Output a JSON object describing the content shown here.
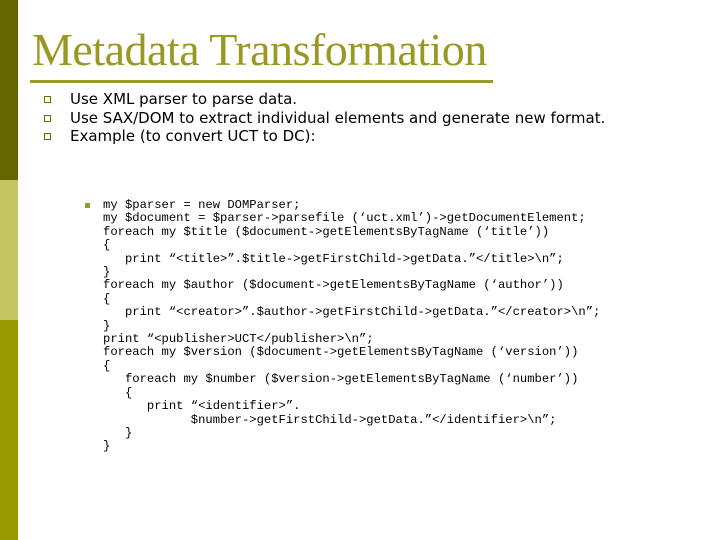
{
  "slide": {
    "title": "Metadata Transformation",
    "colors": {
      "sidebar_dark": "#666600",
      "sidebar_light": "#c3c662",
      "sidebar_mid": "#999900",
      "title": "#999922",
      "rule": "#999933",
      "bullet": "#6b6b00"
    },
    "bullets": [
      {
        "text": "Use XML parser to parse data."
      },
      {
        "text": "Use SAX/DOM to extract individual elements and generate new format."
      },
      {
        "text": "Example (to convert UCT to DC):"
      }
    ],
    "code": {
      "lines": [
        "my $parser = new DOMParser;",
        "my $document = $parser->parsefile (‘uct.xml’)->getDocumentElement;",
        "foreach my $title ($document->getElementsByTagName (‘title’))",
        "{",
        "   print “<title>”.$title->getFirstChild->getData.”</title>\\n”;",
        "}",
        "foreach my $author ($document->getElementsByTagName (‘author’))",
        "{",
        "   print “<creator>”.$author->getFirstChild->getData.”</creator>\\n”;",
        "}",
        "print “<publisher>UCT</publisher>\\n”;",
        "foreach my $version ($document->getElementsByTagName (‘version’))",
        "{",
        "   foreach my $number ($version->getElementsByTagName (‘number’))",
        "   {",
        "      print “<identifier>”.",
        "            $number->getFirstChild->getData.”</identifier>\\n”;",
        "   }",
        "}"
      ]
    }
  }
}
